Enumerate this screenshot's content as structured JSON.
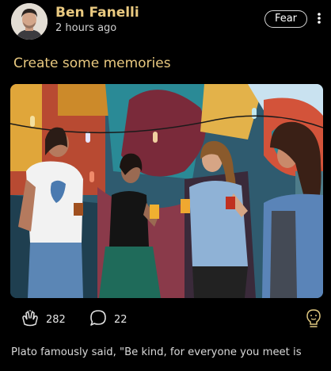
{
  "post": {
    "author_name": "Ben Fanelli",
    "time_ago": "2 hours ago",
    "mood_tag": "Fear",
    "title": "Create some memories",
    "body_text": "Plato famously said, \"Be kind, for everyone you meet is",
    "like_count": "282",
    "comment_count": "22"
  },
  "icons": {
    "more": "vertical-ellipsis-icon",
    "like": "clapping-hands-icon",
    "comment": "speech-bubble-icon",
    "mood": "emoji-lightbulb-icon"
  },
  "colors": {
    "background": "#000000",
    "accent": "#e9c980",
    "text": "#ffffff",
    "muted_text": "#cfcfcf"
  }
}
